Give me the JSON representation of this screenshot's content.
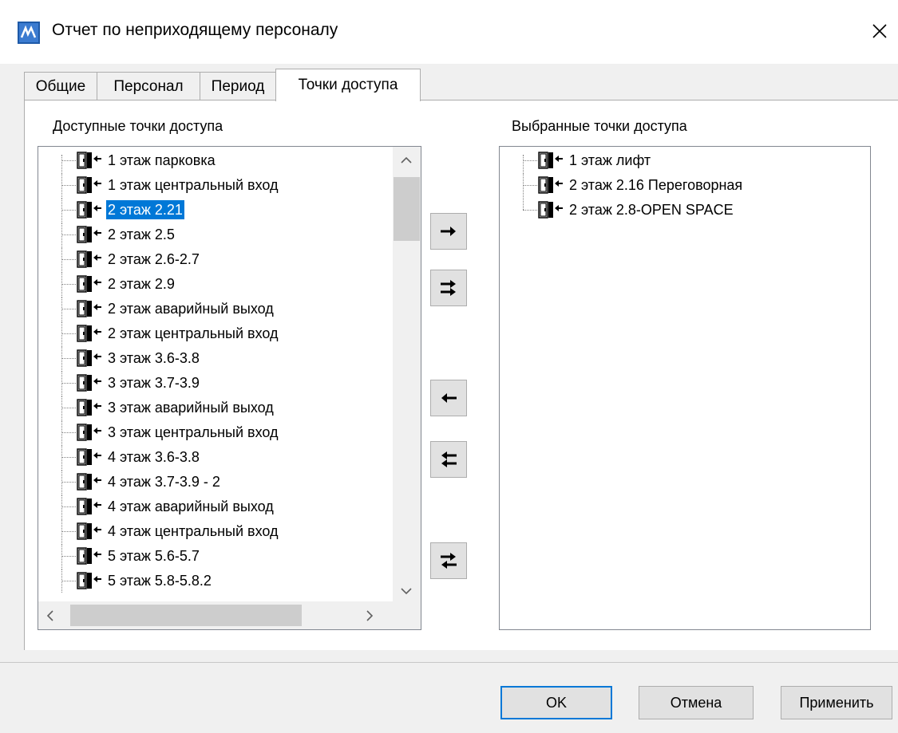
{
  "window": {
    "title": "Отчет по неприходящему персоналу",
    "app_icon": "app-logo-icon",
    "close_icon": "close-icon"
  },
  "tabs": [
    {
      "label": "Общие",
      "active": false
    },
    {
      "label": "Персонал",
      "active": false
    },
    {
      "label": "Период",
      "active": false
    },
    {
      "label": "Точки доступа",
      "active": true
    }
  ],
  "available": {
    "label": "Доступные точки доступа",
    "selected_item": "2 этаж 2.21",
    "items": [
      "1 этаж парковка",
      "1 этаж центральный вход",
      "2 этаж 2.21",
      "2 этаж 2.5",
      "2 этаж 2.6-2.7",
      "2 этаж 2.9",
      "2 этаж аварийный выход",
      "2 этаж центральный вход",
      "3 этаж 3.6-3.8",
      "3 этаж 3.7-3.9",
      "3 этаж аварийный выход",
      "3 этаж центральный вход",
      "4 этаж 3.6-3.8",
      "4 этаж 3.7-3.9 - 2",
      "4 этаж аварийный выход",
      "4 этаж центральный вход",
      "5 этаж 5.6-5.7",
      "5 этаж 5.8-5.8.2"
    ]
  },
  "chosen": {
    "label": "Выбранные точки доступа",
    "items": [
      "1 этаж лифт",
      "2 этаж 2.16 Переговорная",
      "2 этаж 2.8-OPEN SPACE"
    ]
  },
  "move_buttons": [
    {
      "name": "move-right-button",
      "icon": "arrow-right-icon"
    },
    {
      "name": "move-all-right-button",
      "icon": "double-arrow-right-icon"
    },
    {
      "name": "move-left-button",
      "icon": "arrow-left-icon"
    },
    {
      "name": "move-all-left-button",
      "icon": "double-arrow-left-icon"
    },
    {
      "name": "swap-button",
      "icon": "swap-arrows-icon"
    }
  ],
  "buttons": {
    "ok": "OK",
    "cancel": "Отмена",
    "apply": "Применить"
  },
  "colors": {
    "selection": "#0078d7",
    "window_bg": "#f0f0f0",
    "default_button_border": "#0078d7"
  }
}
